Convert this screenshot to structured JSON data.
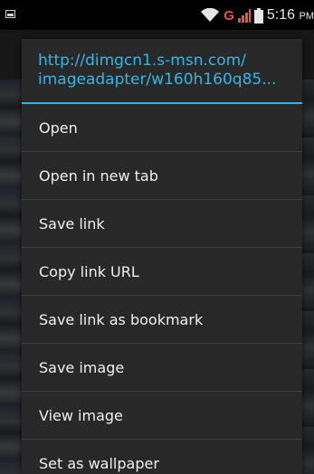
{
  "status_bar": {
    "network_type": "G",
    "time": "5:16",
    "ampm": "PM",
    "colors": {
      "network": "#e8563f",
      "signal": "#e8563f",
      "text": "#e6e6e6"
    }
  },
  "dialog": {
    "title_line1": "http://dimgcn1.s-msn.com/",
    "title_line2": "imageadapter/w160h160q85...",
    "accent_color": "#35b5e5",
    "items": [
      {
        "label": "Open"
      },
      {
        "label": "Open in new tab"
      },
      {
        "label": "Save link"
      },
      {
        "label": "Copy link URL"
      },
      {
        "label": "Save link as bookmark"
      },
      {
        "label": "Save image"
      },
      {
        "label": "View image"
      },
      {
        "label": "Set as wallpaper"
      }
    ]
  }
}
